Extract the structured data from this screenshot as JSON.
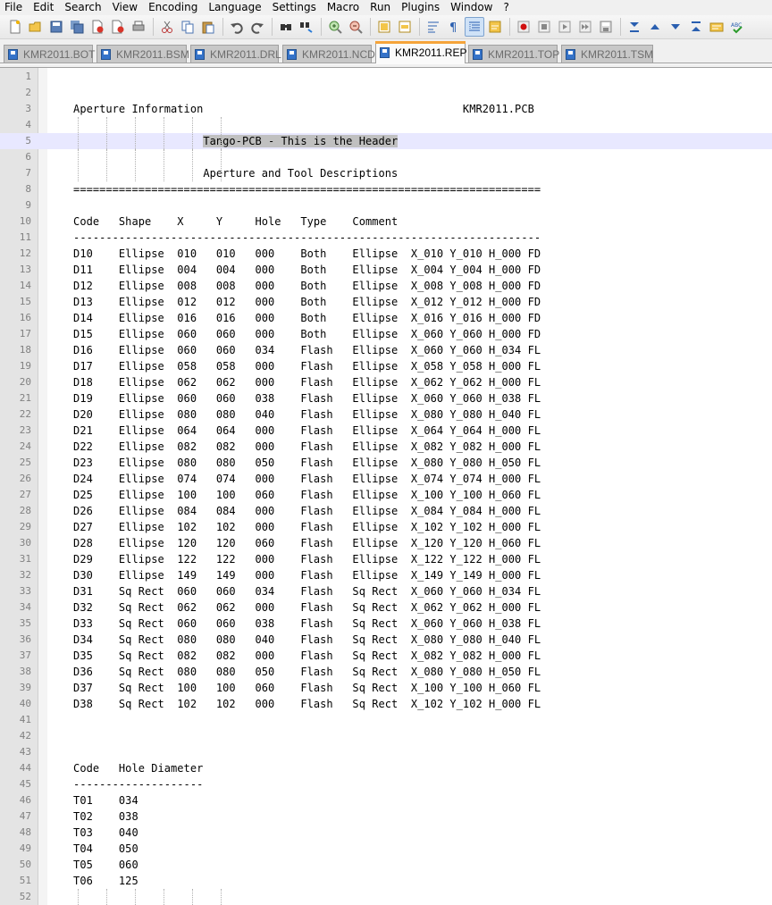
{
  "menu": [
    "File",
    "Edit",
    "Search",
    "View",
    "Encoding",
    "Language",
    "Settings",
    "Macro",
    "Run",
    "Plugins",
    "Window",
    "?"
  ],
  "toolbar": {
    "icons": [
      "new-file-icon",
      "open-file-icon",
      "save-icon",
      "save-all-icon",
      "close-icon",
      "close-all-icon",
      "print-icon",
      "|",
      "cut-icon",
      "copy-icon",
      "paste-icon",
      "|",
      "undo-icon",
      "redo-icon",
      "|",
      "find-icon",
      "replace-icon",
      "|",
      "zoom-in-icon",
      "zoom-out-icon",
      "|",
      "sync-vertical-icon",
      "sync-horizontal-icon",
      "|",
      "word-wrap-icon",
      "show-all-characters-icon",
      "indent-guide-icon",
      "user-defined-language-icon",
      "|",
      "record-macro-icon",
      "stop-recording-icon",
      "playback-macro-icon",
      "run-macro-multiple-icon",
      "save-macro-icon",
      "|",
      "fold-all-icon",
      "collapse-icon",
      "expand-icon",
      "unfold-all-icon",
      "document-map-icon",
      "spell-check-icon"
    ],
    "active_icon": "indent-guide-icon"
  },
  "tabs": [
    {
      "label": "KMR2011.BOT",
      "active": false
    },
    {
      "label": "KMR2011.BSM",
      "active": false
    },
    {
      "label": "KMR2011.DRL",
      "active": false
    },
    {
      "label": "KMR2011.NCD",
      "active": false
    },
    {
      "label": "KMR2011.REP",
      "active": true
    },
    {
      "label": "KMR2011.TOP",
      "active": false
    },
    {
      "label": "KMR2011.TSM",
      "active": false
    }
  ],
  "editor": {
    "current_line": 5,
    "selected_text": "Tango-PCB - This is the Header",
    "lines": [
      "",
      "",
      "    Aperture Information                                        KMR2011.PCB",
      "",
      "                        Tango-PCB - This is the Header",
      "",
      "                        Aperture and Tool Descriptions",
      "    ========================================================================",
      "",
      "    Code   Shape    X     Y     Hole   Type    Comment",
      "    ------------------------------------------------------------------------",
      "    D10    Ellipse  010   010   000    Both    Ellipse  X_010 Y_010 H_000 FD",
      "    D11    Ellipse  004   004   000    Both    Ellipse  X_004 Y_004 H_000 FD",
      "    D12    Ellipse  008   008   000    Both    Ellipse  X_008 Y_008 H_000 FD",
      "    D13    Ellipse  012   012   000    Both    Ellipse  X_012 Y_012 H_000 FD",
      "    D14    Ellipse  016   016   000    Both    Ellipse  X_016 Y_016 H_000 FD",
      "    D15    Ellipse  060   060   000    Both    Ellipse  X_060 Y_060 H_000 FD",
      "    D16    Ellipse  060   060   034    Flash   Ellipse  X_060 Y_060 H_034 FL",
      "    D17    Ellipse  058   058   000    Flash   Ellipse  X_058 Y_058 H_000 FL",
      "    D18    Ellipse  062   062   000    Flash   Ellipse  X_062 Y_062 H_000 FL",
      "    D19    Ellipse  060   060   038    Flash   Ellipse  X_060 Y_060 H_038 FL",
      "    D20    Ellipse  080   080   040    Flash   Ellipse  X_080 Y_080 H_040 FL",
      "    D21    Ellipse  064   064   000    Flash   Ellipse  X_064 Y_064 H_000 FL",
      "    D22    Ellipse  082   082   000    Flash   Ellipse  X_082 Y_082 H_000 FL",
      "    D23    Ellipse  080   080   050    Flash   Ellipse  X_080 Y_080 H_050 FL",
      "    D24    Ellipse  074   074   000    Flash   Ellipse  X_074 Y_074 H_000 FL",
      "    D25    Ellipse  100   100   060    Flash   Ellipse  X_100 Y_100 H_060 FL",
      "    D26    Ellipse  084   084   000    Flash   Ellipse  X_084 Y_084 H_000 FL",
      "    D27    Ellipse  102   102   000    Flash   Ellipse  X_102 Y_102 H_000 FL",
      "    D28    Ellipse  120   120   060    Flash   Ellipse  X_120 Y_120 H_060 FL",
      "    D29    Ellipse  122   122   000    Flash   Ellipse  X_122 Y_122 H_000 FL",
      "    D30    Ellipse  149   149   000    Flash   Ellipse  X_149 Y_149 H_000 FL",
      "    D31    Sq Rect  060   060   034    Flash   Sq Rect  X_060 Y_060 H_034 FL",
      "    D32    Sq Rect  062   062   000    Flash   Sq Rect  X_062 Y_062 H_000 FL",
      "    D33    Sq Rect  060   060   038    Flash   Sq Rect  X_060 Y_060 H_038 FL",
      "    D34    Sq Rect  080   080   040    Flash   Sq Rect  X_080 Y_080 H_040 FL",
      "    D35    Sq Rect  082   082   000    Flash   Sq Rect  X_082 Y_082 H_000 FL",
      "    D36    Sq Rect  080   080   050    Flash   Sq Rect  X_080 Y_080 H_050 FL",
      "    D37    Sq Rect  100   100   060    Flash   Sq Rect  X_100 Y_100 H_060 FL",
      "    D38    Sq Rect  102   102   000    Flash   Sq Rect  X_102 Y_102 H_000 FL",
      "",
      "",
      "",
      "    Code   Hole Diameter",
      "    --------------------",
      "    T01    034",
      "    T02    038",
      "    T03    040",
      "    T04    050",
      "    T05    060",
      "    T06    125",
      ""
    ]
  },
  "colors": {
    "current_line": "#e8e8ff",
    "selection": "#c0c0c0",
    "active_tab_accent": "#f5a43a",
    "line_number": "#808080"
  }
}
